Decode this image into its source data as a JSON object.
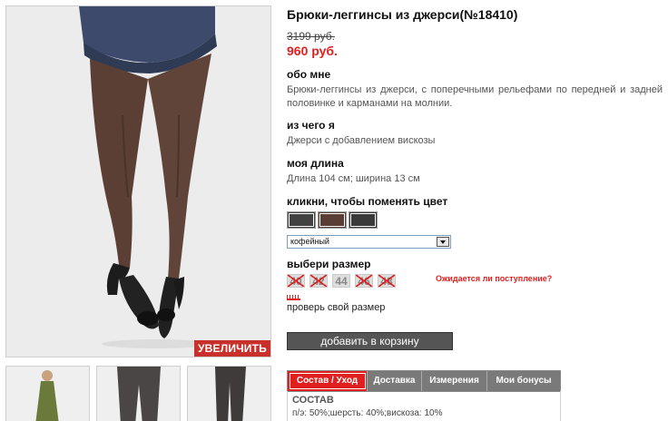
{
  "product": {
    "title": "Брюки-леггинсы из джерси(№18410)",
    "old_price": "3199 руб.",
    "new_price": "960 руб."
  },
  "photo": {
    "zoom_label": "УВЕЛИЧИТЬ"
  },
  "sections": {
    "about_heading": "обо мне",
    "about_text": "Брюки-леггинсы из джерси, с поперечными рельефами по передней и задней половинке и карманами на молнии.",
    "material_heading": "из чего я",
    "material_text": "Джерси с добавлением вискозы",
    "length_heading": "моя длина",
    "length_text": "Длина 104 см; ширина 13 см",
    "color_heading": "кликни, чтобы поменять цвет",
    "size_heading": "выбери размер"
  },
  "colors": {
    "swatches": [
      "#424242",
      "#5a3e35",
      "#3a3a3a"
    ],
    "selected": "кофейный"
  },
  "sizes": [
    {
      "label": "40",
      "available": false
    },
    {
      "label": "42",
      "available": false
    },
    {
      "label": "44",
      "available": true
    },
    {
      "label": "46",
      "available": false
    },
    {
      "label": "48",
      "available": false
    }
  ],
  "links": {
    "expected": "Ожидается ли поступление?",
    "check_size": "проверь свой размер"
  },
  "cart_button": "добавить в корзину",
  "tabs": [
    "Состав / Уход",
    "Доставка",
    "Измерения",
    "Мои бонусы"
  ],
  "composition": {
    "heading": "СОСТАВ",
    "text": "п/э: 50%;шерсть: 40%;вискоза: 10%"
  },
  "accent_color": "#e0201f"
}
